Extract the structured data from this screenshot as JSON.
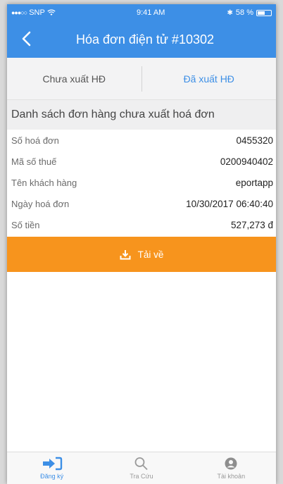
{
  "status": {
    "carrier": "SNP",
    "time": "9:41 AM",
    "battery_text": "58 %",
    "battery_level": 0.58
  },
  "header": {
    "title": "Hóa đơn điện tử #10302"
  },
  "tabs": [
    {
      "label": "Chưa xuất HĐ",
      "active": false
    },
    {
      "label": "Đã xuất HĐ",
      "active": true
    }
  ],
  "section": {
    "title": "Danh sách đơn hàng chưa xuất hoá đơn"
  },
  "details": [
    {
      "label": "Số hoá đơn",
      "value": "0455320"
    },
    {
      "label": "Mã số thuế",
      "value": "0200940402"
    },
    {
      "label": "Tên khách hàng",
      "value": "eportapp"
    },
    {
      "label": "Ngày hoá đơn",
      "value": "10/30/2017 06:40:40"
    },
    {
      "label": "Số tiền",
      "value": "527,273 đ"
    }
  ],
  "download": {
    "label": "Tải về"
  },
  "tabbar": [
    {
      "label": "Đăng ký",
      "icon": "sign-in-icon",
      "active": true
    },
    {
      "label": "Tra Cứu",
      "icon": "search-icon",
      "active": false
    },
    {
      "label": "Tài khoản",
      "icon": "account-icon",
      "active": false
    }
  ],
  "colors": {
    "primary": "#3d8fe6",
    "accent": "#f7941d"
  }
}
